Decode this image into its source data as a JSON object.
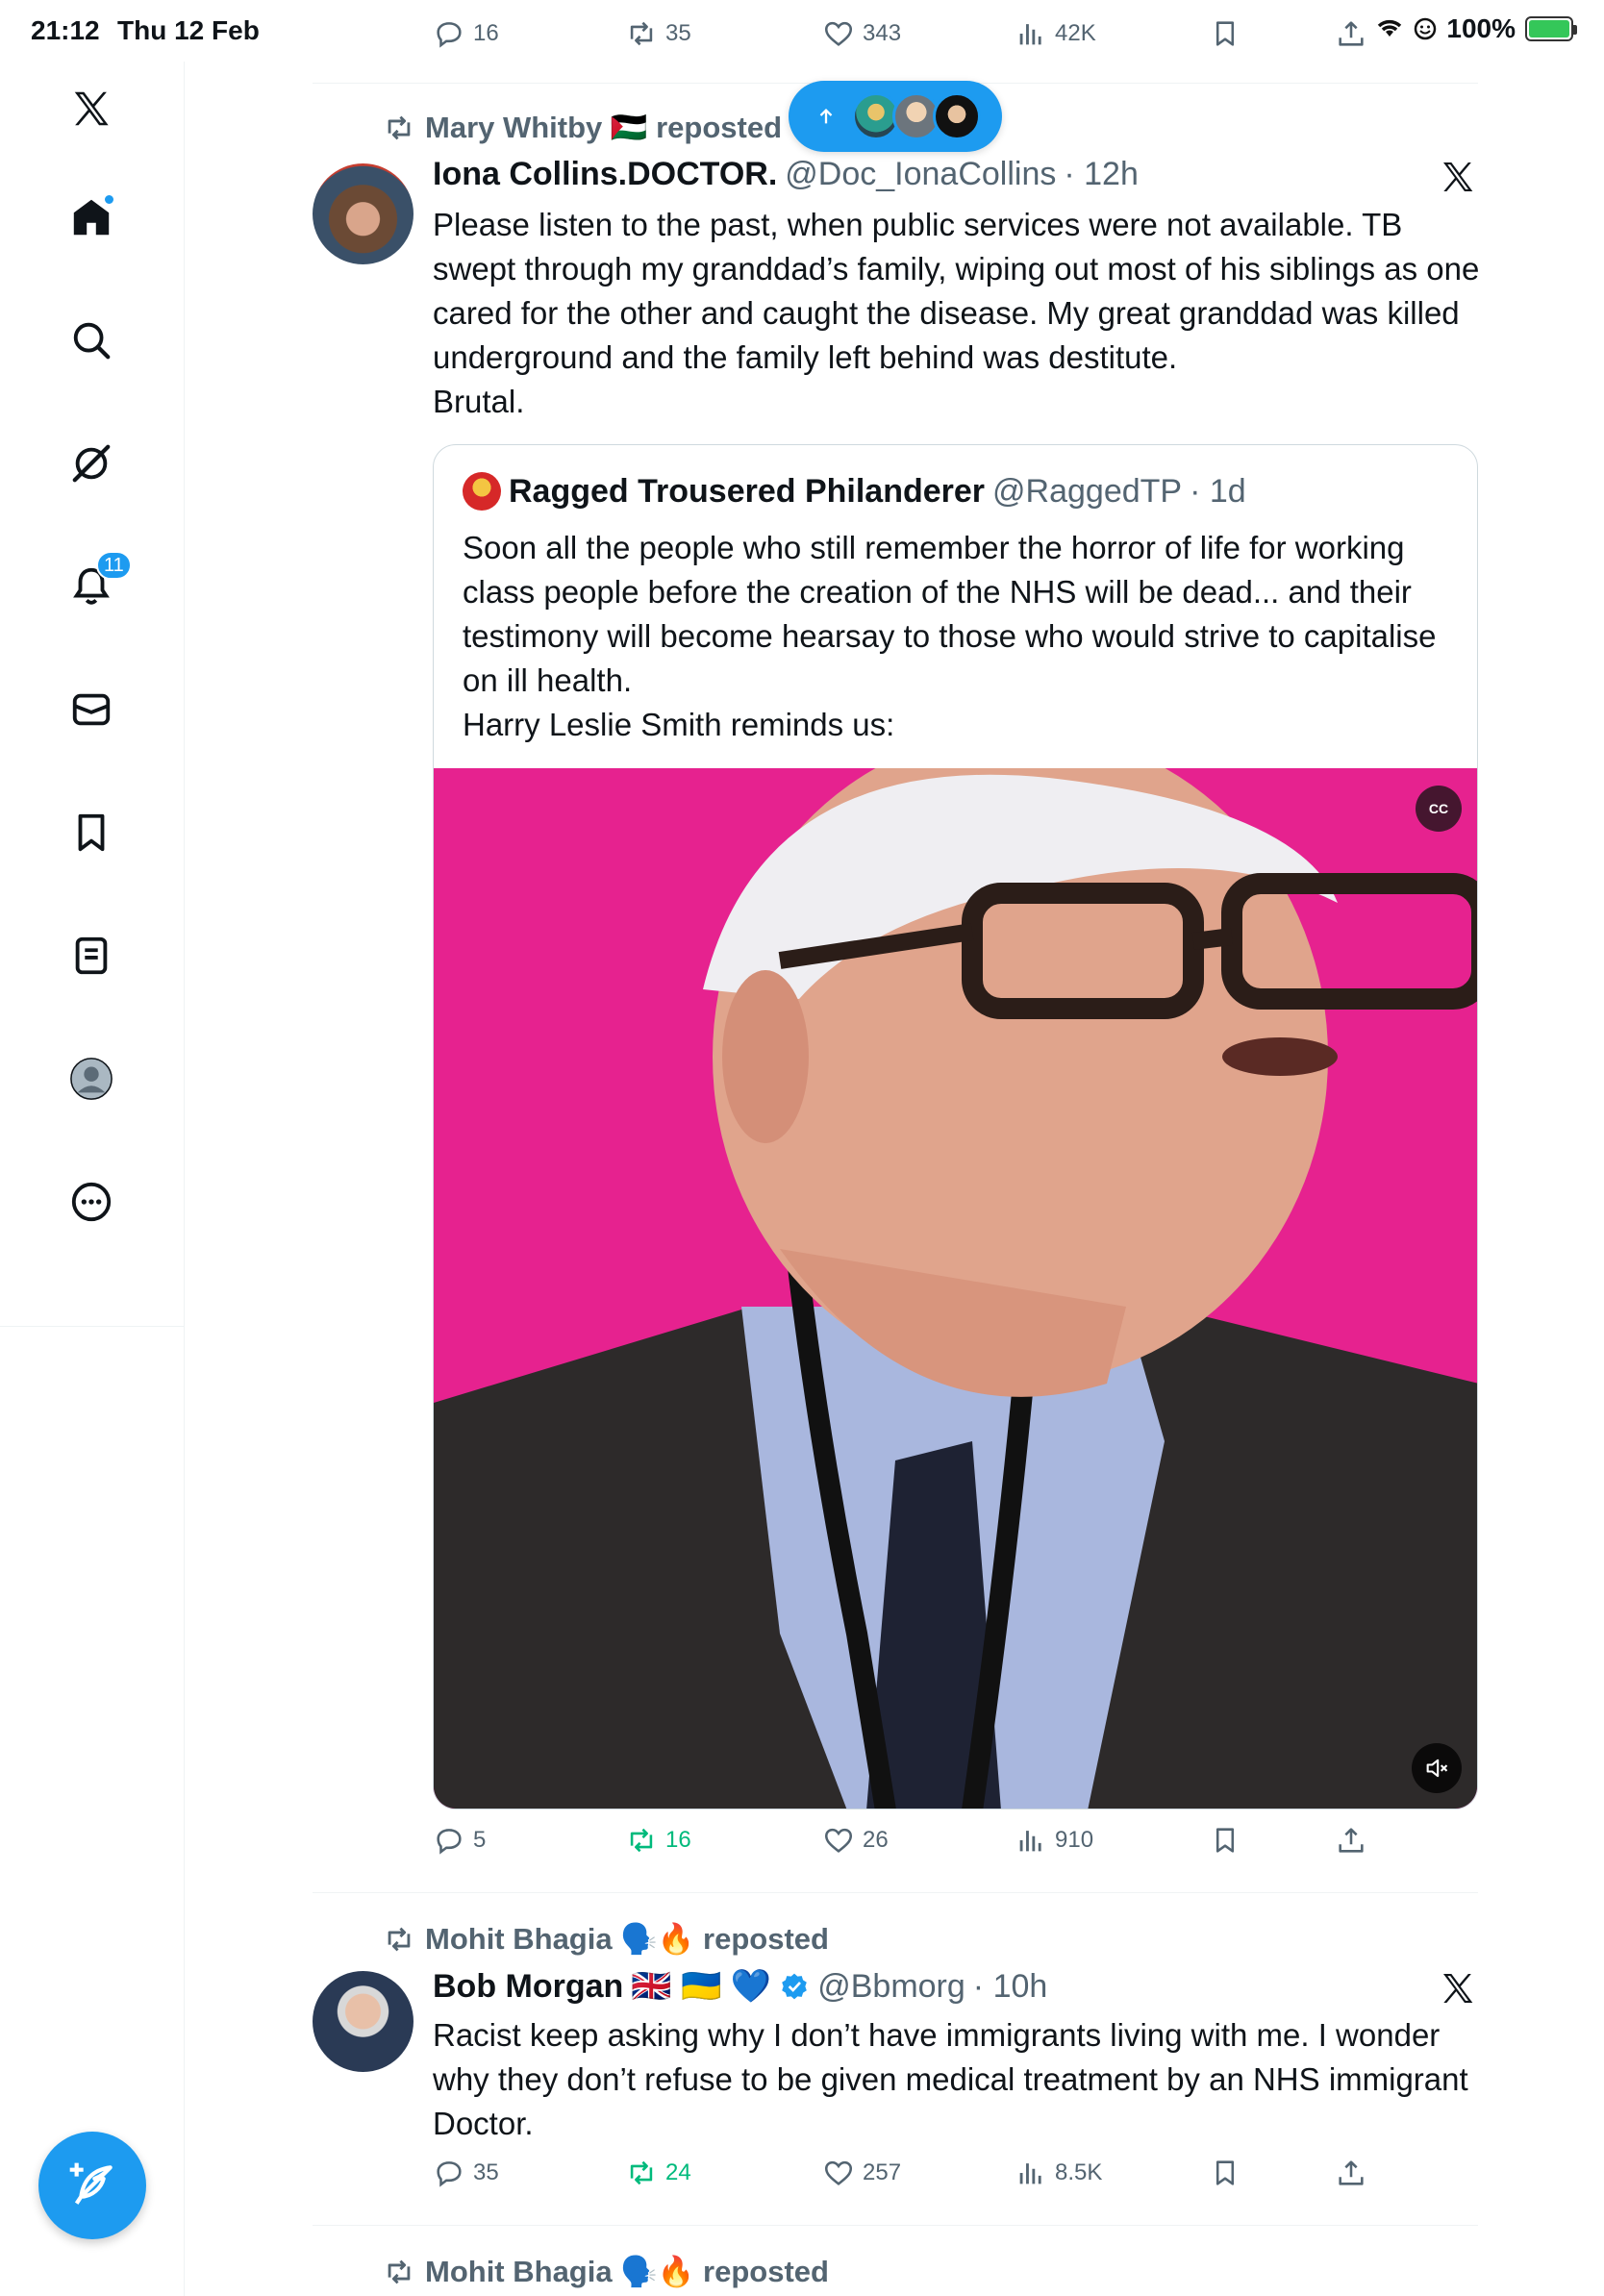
{
  "status_bar": {
    "time": "21:12",
    "date": "Thu 12 Feb",
    "battery": "100%"
  },
  "sidebar": {
    "notifications_badge": "11",
    "items": [
      "x-logo",
      "home",
      "search",
      "grok",
      "notifications",
      "messages",
      "bookmarks",
      "lists",
      "profile",
      "more"
    ]
  },
  "new_posts_pill": {
    "icon": "arrow-up"
  },
  "top_actions": {
    "replies": "16",
    "reposts": "35",
    "likes": "343",
    "views": "42K"
  },
  "tweet1": {
    "reposted_by": "Mary Whitby 🇵🇸 reposted",
    "name": "Iona Collins.DOCTOR.",
    "handle": "@Doc_IonaCollins",
    "time": "· 12h",
    "text": "Please listen to the past, when public services were not available. TB swept through my granddad’s family, wiping out most of his siblings as one cared for the other and caught the disease. My great granddad was killed underground and the family left behind was destitute.\nBrutal.",
    "quote": {
      "name": "Ragged Trousered Philanderer",
      "handle": "@RaggedTP",
      "time": "· 1d",
      "text": "Soon all the people who still remember the horror of life for working class people before the creation of the NHS will be dead... and their testimony will become hearsay to those who would strive to capitalise on ill health.\nHarry Leslie Smith reminds us:",
      "cc_label": "CC"
    },
    "actions": {
      "replies": "5",
      "reposts": "16",
      "likes": "26",
      "views": "910"
    }
  },
  "tweet2": {
    "reposted_by": "Mohit Bhagia 🗣️🔥 reposted",
    "name": "Bob Morgan",
    "flags": "🇬🇧 🇺🇦 💙",
    "handle": "@Bbmorg",
    "time": "· 10h",
    "text": "Racist keep asking why I don’t have immigrants living with me. I wonder why they don’t refuse to be given medical treatment by an NHS immigrant Doctor.",
    "actions": {
      "replies": "35",
      "reposts": "24",
      "likes": "257",
      "views": "8.5K"
    }
  },
  "tweet3": {
    "reposted_by": "Mohit Bhagia 🗣️🔥 reposted"
  },
  "colors": {
    "accent": "#1d9bf0",
    "repost_green": "#00ba7c",
    "muted_text": "#536471",
    "media_bg": "#e6228f"
  }
}
